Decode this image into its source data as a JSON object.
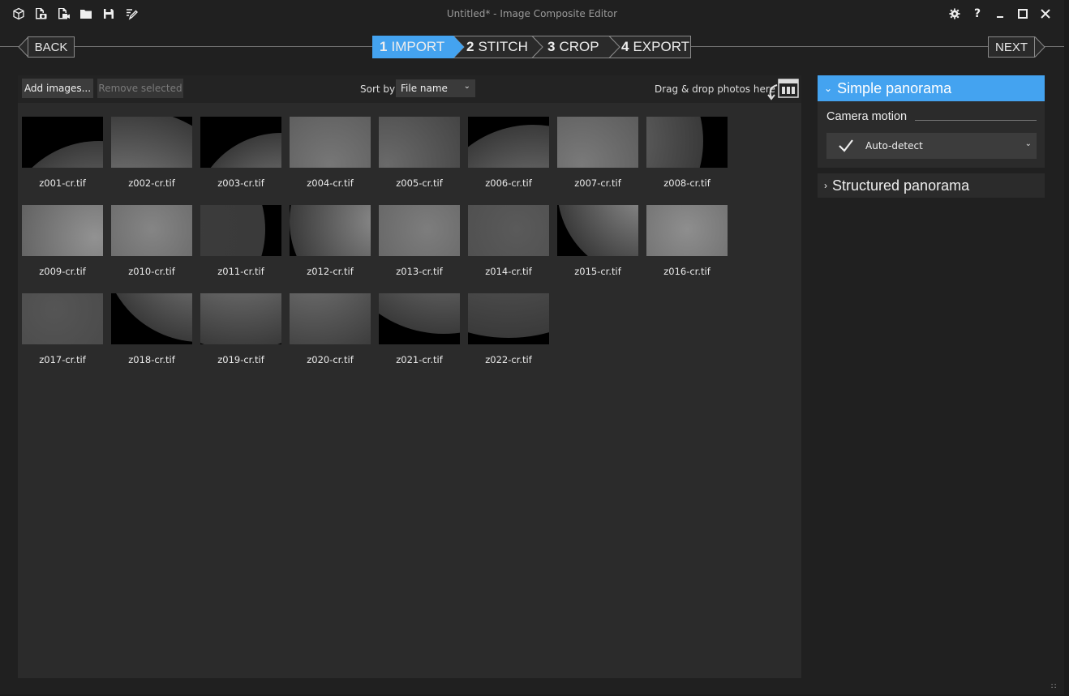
{
  "window": {
    "title": "Untitled* - Image Composite Editor"
  },
  "titlebar_icons": [
    "new-project-icon",
    "new-from-camera-icon",
    "new-from-video-icon",
    "open-folder-icon",
    "save-icon",
    "edit-icon"
  ],
  "window_controls": [
    "settings-icon",
    "help-icon",
    "minimize-icon",
    "maximize-icon",
    "close-icon"
  ],
  "nav": {
    "back_label": "BACK",
    "next_label": "NEXT",
    "steps": [
      {
        "num": "1",
        "label": "IMPORT",
        "active": true
      },
      {
        "num": "2",
        "label": "STITCH",
        "active": false
      },
      {
        "num": "3",
        "label": "CROP",
        "active": false
      },
      {
        "num": "4",
        "label": "EXPORT",
        "active": false
      }
    ]
  },
  "toolbar": {
    "add_label": "Add images...",
    "remove_label": "Remove selected",
    "sort_label": "Sort by",
    "sort_value": "File name",
    "drop_label": "Drag & drop photos here"
  },
  "images": [
    "z001-cr.tif",
    "z002-cr.tif",
    "z003-cr.tif",
    "z004-cr.tif",
    "z005-cr.tif",
    "z006-cr.tif",
    "z007-cr.tif",
    "z008-cr.tif",
    "z009-cr.tif",
    "z010-cr.tif",
    "z011-cr.tif",
    "z012-cr.tif",
    "z013-cr.tif",
    "z014-cr.tif",
    "z015-cr.tif",
    "z016-cr.tif",
    "z017-cr.tif",
    "z018-cr.tif",
    "z019-cr.tif",
    "z020-cr.tif",
    "z021-cr.tif",
    "z022-cr.tif"
  ],
  "settings": {
    "simple_label": "Simple panorama",
    "camera_motion_label": "Camera motion",
    "camera_motion_value": "Auto-detect",
    "structured_label": "Structured panorama"
  },
  "colors": {
    "accent": "#44a3f0",
    "background": "#202020",
    "panel": "#2b2b2b"
  }
}
